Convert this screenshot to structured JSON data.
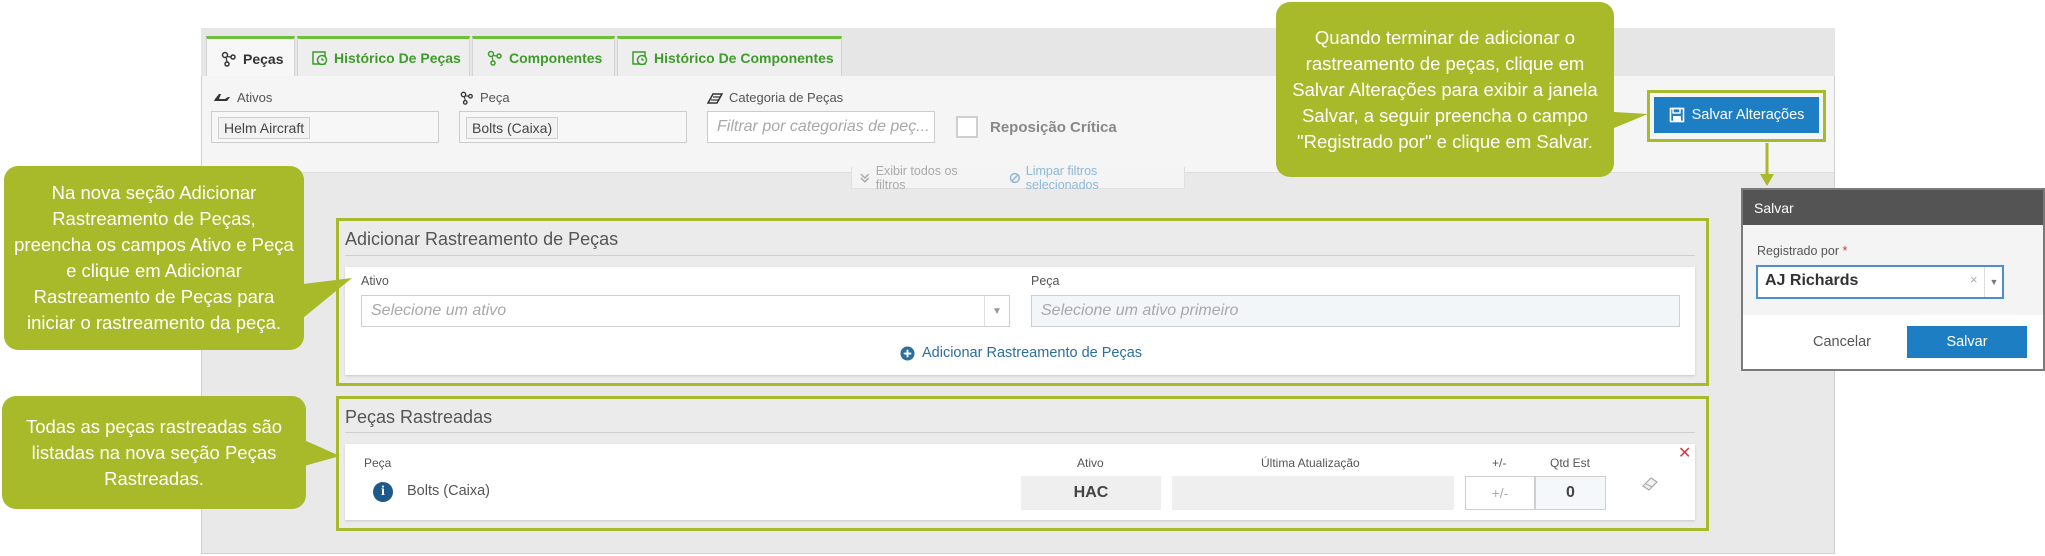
{
  "tabs": [
    {
      "label": "Peças",
      "icon": "part-node-icon"
    },
    {
      "label": "Histórico De Peças",
      "icon": "history-icon"
    },
    {
      "label": "Componentes",
      "icon": "component-node-icon"
    },
    {
      "label": "Histórico De Componentes",
      "icon": "history-icon"
    }
  ],
  "filters": {
    "assets_label": "Ativos",
    "assets_value": "Helm Aircraft",
    "part_label": "Peça",
    "part_value": "Bolts (Caixa)",
    "category_label": "Categoria de Peças",
    "category_placeholder": "Filtrar por categorias de peç...",
    "critical_label": "Reposição Crítica",
    "show_all": "Exibir todos os filtros",
    "clear_selected": "Limpar filtros selecionados"
  },
  "toolbar": {
    "save_changes_label": "Salvar Alterações"
  },
  "add_section": {
    "title": "Adicionar Rastreamento de Peças",
    "asset_label": "Ativo",
    "asset_placeholder": "Selecione um ativo",
    "part_label": "Peça",
    "part_placeholder": "Selecione um ativo primeiro",
    "add_button": "Adicionar Rastreamento de Peças"
  },
  "tracked_section": {
    "title": "Peças Rastreadas",
    "columns": {
      "part": "Peça",
      "asset": "Ativo",
      "last_update": "Última Atualização",
      "plus_minus": "+/-",
      "qty": "Qtd Est"
    },
    "row": {
      "part": "Bolts (Caixa)",
      "asset": "HAC",
      "last_update": "",
      "plus_minus_placeholder": "+/-",
      "qty": "0"
    }
  },
  "dialog": {
    "title": "Salvar",
    "registered_label": "Registrado por",
    "required_mark": "*",
    "registered_value": "AJ Richards",
    "clear_mark": "×",
    "cancel_label": "Cancelar",
    "save_label": "Salvar"
  },
  "callouts": {
    "top": "Quando terminar de adicionar o rastreamento de peças, clique em Salvar Alterações para exibir a janela Salvar, a seguir preencha o campo \"Registrado por\" e clique em Salvar.",
    "left_add": "Na nova seção Adicionar Rastreamento de Peças, preencha os campos Ativo e Peça e clique em Adicionar Rastreamento de Peças para iniciar o rastreamento da peça.",
    "left_tracked": "Todas as peças rastreadas são listadas na nova seção Peças Rastreadas."
  },
  "colors": {
    "accent_green": "#a8b92a",
    "primary_blue": "#1d7ec3",
    "tab_green": "#3f9b2b",
    "danger_red": "#d23b3b"
  }
}
